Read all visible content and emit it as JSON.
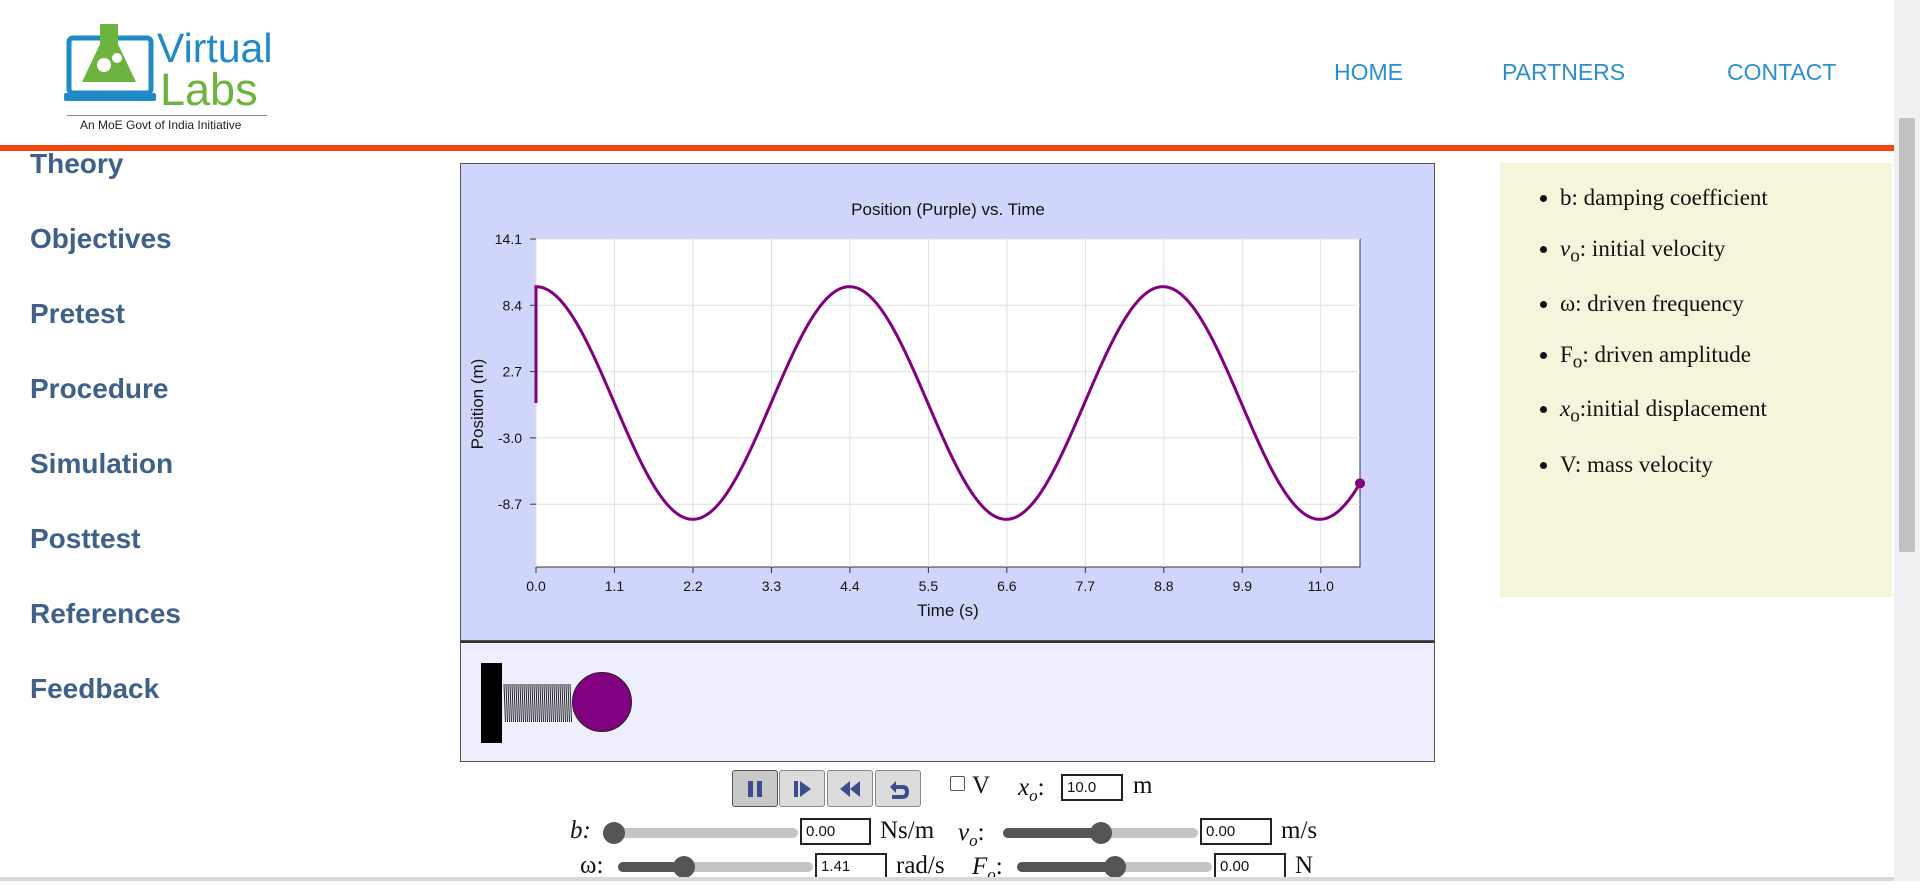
{
  "header": {
    "logo": {
      "line1": "Virtual",
      "line2": "Labs",
      "tagline": "An MoE Govt of India Initiative"
    },
    "nav": [
      {
        "label": "HOME"
      },
      {
        "label": "PARTNERS"
      },
      {
        "label": "CONTACT"
      }
    ]
  },
  "sidebar": {
    "items": [
      {
        "label": "Theory"
      },
      {
        "label": "Objectives"
      },
      {
        "label": "Pretest"
      },
      {
        "label": "Procedure"
      },
      {
        "label": "Simulation"
      },
      {
        "label": "Posttest"
      },
      {
        "label": "References"
      },
      {
        "label": "Feedback"
      }
    ]
  },
  "chart_data": {
    "type": "line",
    "title": "Position (Purple) vs. Time",
    "xlabel": "Time (s)",
    "ylabel": "Position (m)",
    "xlim": [
      0,
      11.55
    ],
    "ylim": [
      -14.1,
      14.1
    ],
    "x_ticks": [
      "0.0",
      "1.1",
      "2.2",
      "3.3",
      "4.4",
      "5.5",
      "6.6",
      "7.7",
      "8.8",
      "9.9",
      "11.0"
    ],
    "y_ticks": [
      "14.1",
      "8.4",
      "2.7",
      "-3.0",
      "-8.7"
    ],
    "y_tick_values": [
      14.1,
      8.4,
      2.7,
      -3.0,
      -8.7
    ],
    "grid": true,
    "series": [
      {
        "name": "Position",
        "color": "#800080",
        "amplitude": 10.0,
        "omega": 1.43,
        "t_end": 11.55
      }
    ]
  },
  "info": {
    "items": [
      {
        "sym": "",
        "sub": "",
        "text": "b: damping coefficient"
      },
      {
        "sym": "v",
        "sub": "o",
        "text": ": initial velocity"
      },
      {
        "sym": "",
        "sub": "",
        "text": "ω: driven frequency"
      },
      {
        "sym": "F",
        "sub": "o",
        "text": ": driven amplitude"
      },
      {
        "sym": "x",
        "sub": "o",
        "text": ":initial displacement"
      },
      {
        "sym": "",
        "sub": "",
        "text": "V: mass velocity"
      }
    ]
  },
  "controls": {
    "buttons": [
      {
        "name": "pause",
        "icon": "pause-icon"
      },
      {
        "name": "step",
        "icon": "step-forward-icon"
      },
      {
        "name": "rewind",
        "icon": "rewind-icon"
      },
      {
        "name": "reset",
        "icon": "undo-icon"
      }
    ],
    "v_checkbox_label": "V",
    "x0": {
      "label_sym": "x",
      "label_sub": "o",
      "value": "10.0",
      "unit": "m"
    },
    "b": {
      "label": "b:",
      "value": "0.00",
      "unit": "Ns/m",
      "fraction": 0.0
    },
    "v0": {
      "label_sym": "v",
      "label_sub": "o",
      "value": "0.00",
      "unit": "m/s",
      "fraction": 0.5
    },
    "omega": {
      "label": "ω:",
      "value": "1.41",
      "unit": "rad/s",
      "fraction": 0.32
    },
    "F0": {
      "label_sym": "F",
      "label_sub": "o",
      "value": "0.00",
      "unit": "N",
      "fraction": 0.5
    }
  },
  "colors": {
    "accent": "#f04610",
    "nav": "#2c8fcf",
    "sidebar": "#3e6089",
    "series": "#800080",
    "chart_bg": "#d0d6fb"
  }
}
